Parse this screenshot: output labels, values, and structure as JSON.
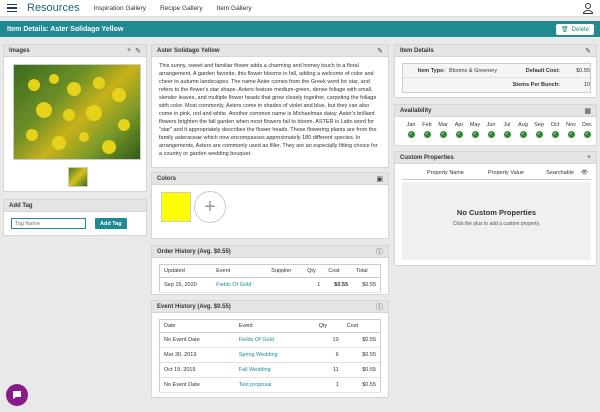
{
  "topbar": {
    "brand": "Resources",
    "nav": [
      "Inspiration Gallery",
      "Recipe Gallery",
      "Item Gallery"
    ]
  },
  "header": {
    "title": "Item Details: Aster Solidago Yellow",
    "delete_label": "Delete"
  },
  "images": {
    "title": "Images"
  },
  "add_tag": {
    "title": "Add Tag",
    "placeholder": "Tag Name",
    "button": "Add Tag"
  },
  "description": {
    "title": "Aster Solidago Yellow",
    "text": "This sunny, sweet and familiar flower adds a charming and homey touch to a floral arrangement. A garden favorite, this flower blooms in fall, adding a welcome of color and cheer to autumn landscapes. The name Aster comes from the Greek word for star, and refers to the flower's star shape. Asters feature medium-green, dense foliage with small, slender leaves, and multiple flower heads that grow closely together, carpeting the foliage with color. Most commonly, Asters come in shades of violet and blue, but they can also come in pink, red and white. Another common name is Michaelmas daisy. Aster's brilliant flowers brighten the fall garden when most flowers fail to bloom. ASTER is Latin word for \"star\" and it appropriately describes the flower heads. These flowering plants are from the family asteraceae which now encompasses approximately 180 different species. In arrangements, Asters are commonly used as filler. They are an especially fitting choice for a country or garden wedding bouquet."
  },
  "colors": {
    "title": "Colors",
    "swatch": "#ffff00"
  },
  "order_history": {
    "title": "Order History (Avg. $0.55)",
    "headers": [
      "Updated",
      "Event",
      "Supplier",
      "Qty",
      "Cost",
      "Total"
    ],
    "rows": [
      {
        "updated": "Sep 15, 2020",
        "event": "Fields Of Gold",
        "supplier": "",
        "qty": "1",
        "cost": "$0.55",
        "total": "$0.55"
      }
    ]
  },
  "event_history": {
    "title": "Event History (Avg. $0.55)",
    "headers": [
      "Date",
      "Event",
      "Qty",
      "Cost"
    ],
    "rows": [
      {
        "date": "No Event Date",
        "event": "Fields Of Gold",
        "qty": "10",
        "cost": "$0.55"
      },
      {
        "date": "Mar 30, 2019",
        "event": "Spring Wedding",
        "qty": "6",
        "cost": "$0.55"
      },
      {
        "date": "Oct 19, 2019",
        "event": "Fall Wedding",
        "qty": "11",
        "cost": "$0.55"
      },
      {
        "date": "No Event Date",
        "event": "Test proposal",
        "qty": "1",
        "cost": "$0.55"
      }
    ]
  },
  "item_details": {
    "title": "Item Details",
    "item_type_label": "Item Type:",
    "item_type": "Blooms & Greenery",
    "default_cost_label": "Default Cost:",
    "default_cost": "$0.55",
    "stems_label": "Stems Per Bunch:",
    "stems": "10"
  },
  "availability": {
    "title": "Availability",
    "months": [
      "Jan",
      "Feb",
      "Mar",
      "Apr",
      "May",
      "Jun",
      "Jul",
      "Aug",
      "Sep",
      "Oct",
      "Nov",
      "Dec"
    ],
    "check": "✓"
  },
  "custom_properties": {
    "title": "Custom Properties",
    "headers": [
      "Property Name",
      "Property Value",
      "Searchable"
    ],
    "empty_title": "No Custom Properties",
    "empty_text": "Click the plus to add a custom property."
  }
}
